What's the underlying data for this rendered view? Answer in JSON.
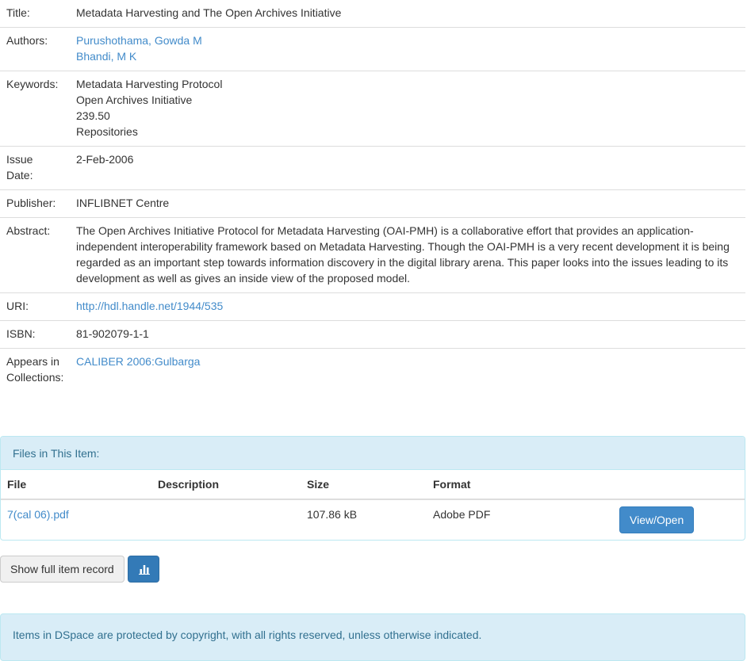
{
  "record": {
    "title_label": "Title:",
    "title": "Metadata Harvesting and The Open Archives Initiative",
    "authors_label": "Authors:",
    "authors": [
      "Purushothama, Gowda M",
      "Bhandi, M K"
    ],
    "keywords_label": "Keywords:",
    "keywords": [
      "Metadata Harvesting Protocol",
      "Open Archives Initiative",
      "239.50",
      "Repositories"
    ],
    "issue_date_label_line1": "Issue",
    "issue_date_label_line2": "Date:",
    "issue_date": "2-Feb-2006",
    "publisher_label": "Publisher:",
    "publisher": "INFLIBNET Centre",
    "abstract_label": "Abstract:",
    "abstract": "The Open Archives Initiative Protocol for Metadata Harvesting (OAI-PMH) is a collaborative effort that provides an application-independent interoperability framework based on Metadata Harvesting. Though the OAI-PMH is a very recent development it is being regarded as an important step towards information discovery in the digital library arena. This paper looks into the issues leading to its development as well as gives an inside view of the proposed model.",
    "uri_label": "URI:",
    "uri": "http://hdl.handle.net/1944/535",
    "isbn_label": "ISBN:",
    "isbn": "81-902079-1-1",
    "collections_label_line1": "Appears in",
    "collections_label_line2": "Collections:",
    "collection": "CALIBER 2006:Gulbarga"
  },
  "files": {
    "heading": "Files in This Item:",
    "columns": [
      "File",
      "Description",
      "Size",
      "Format"
    ],
    "rows": [
      {
        "file": "7(cal 06).pdf",
        "description": "",
        "size": "107.86 kB",
        "format": "Adobe PDF",
        "action": "View/Open"
      }
    ]
  },
  "actions": {
    "full_record_label": "Show full item record",
    "stats_icon": "bar-chart-icon"
  },
  "footer": {
    "notice": "Items in DSpace are protected by copyright, with all rights reserved, unless otherwise indicated."
  },
  "colors": {
    "link": "#428bca",
    "panel_bg": "#d9edf7",
    "panel_text": "#31708f",
    "primary": "#428bca"
  }
}
